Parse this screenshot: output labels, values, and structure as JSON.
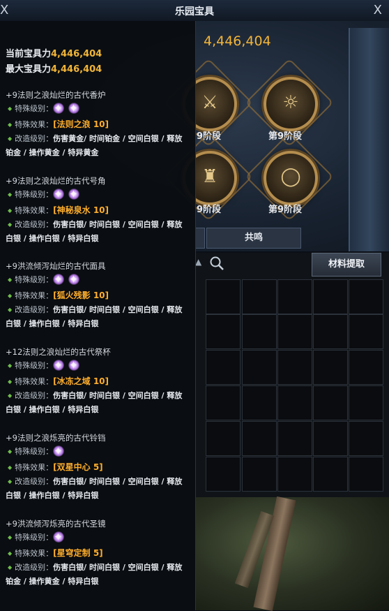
{
  "window": {
    "title": "乐园宝具",
    "close_label": "X",
    "close_left_label": "X"
  },
  "main": {
    "power_display": "4,446,404",
    "relics": [
      {
        "stage": "9阶段",
        "icon": "sword-relic-icon"
      },
      {
        "stage": "第9阶段",
        "icon": "mask-relic-icon"
      },
      {
        "stage": "9阶段",
        "icon": "bell-relic-icon"
      },
      {
        "stage": "第9阶段",
        "icon": "mirror-relic-icon"
      }
    ],
    "tabs": [
      {
        "label": ""
      },
      {
        "label": "共鸣"
      }
    ],
    "extract_button": "材料提取"
  },
  "tooltip": {
    "current_power_label": "当前宝具力",
    "current_power_value": "4,446,404",
    "max_power_label": "最大宝具力",
    "max_power_value": "4,446,404",
    "special_grade_label": "特殊级别：",
    "special_effect_label": "特殊效果：",
    "modify_label": "改造级别：",
    "items": [
      {
        "title": "+9法则之浪灿烂的古代香炉",
        "stars": 2,
        "effect": "[法则之浪 10]",
        "modify_line1": "伤害黄金/ 时间铂金 / 空间白银 / 释放",
        "modify_line2": "铂金 / 操作黄金 / 特异黄金"
      },
      {
        "title": "+9法则之浪灿烂的古代号角",
        "stars": 2,
        "effect": "[神秘泉水 10]",
        "modify_line1": "伤害白银/ 时间白银 / 空间白银 / 释放",
        "modify_line2": "白银 / 操作白银 / 特异白银"
      },
      {
        "title": "+9洪流倾泻灿烂的古代面具",
        "stars": 2,
        "effect": "[狐火残影 10]",
        "modify_line1": "伤害白银/ 时间白银 / 空间白银 / 释放",
        "modify_line2": "白银 / 操作白银 / 特异白银"
      },
      {
        "title": "+12法则之浪灿烂的古代祭杯",
        "stars": 2,
        "effect": "[冰冻之域 10]",
        "modify_line1": "伤害白银/ 时间白银 / 空间白银 / 释放",
        "modify_line2": "白银 / 操作白银 / 特异白银"
      },
      {
        "title": "+9法则之浪烁亮的古代铃铛",
        "stars": 1,
        "effect": "[双星中心 5]",
        "modify_line1": "伤害白银/ 时间白银 / 空间白银 / 释放",
        "modify_line2": "白银 / 操作白银 / 特异白银"
      },
      {
        "title": "+9洪流倾泻烁亮的古代圣镜",
        "stars": 1,
        "effect": "[星穹定制 5]",
        "modify_line1": "伤害白银/ 时间白银 / 空间白银 / 释放",
        "modify_line2": "铂金 / 操作黄金 / 特异白银"
      }
    ]
  }
}
